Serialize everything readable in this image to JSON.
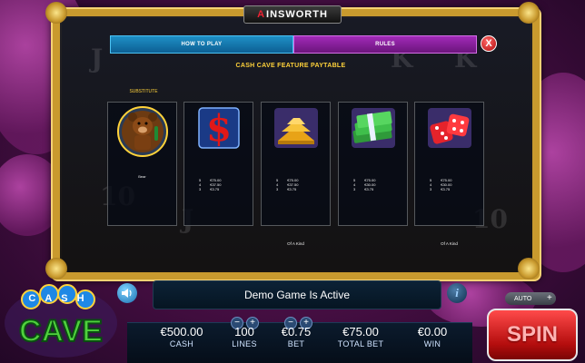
{
  "brand": {
    "name_first": "A",
    "name_rest": "INSWORTH"
  },
  "tabs": {
    "how_to_play": "HOW TO PLAY",
    "rules": "RULES"
  },
  "close_label": "X",
  "paytable": {
    "title": "CASH CAVE FEATURE PAYTABLE",
    "substitute_label": "SUBSTITUTE",
    "bear_caption": "Bear",
    "cards": [
      {
        "icon": "bear-icon",
        "pays": []
      },
      {
        "icon": "dollar-sign-icon",
        "pays": [
          [
            "5",
            "€75.00"
          ],
          [
            "4",
            "€37.50"
          ],
          [
            "3",
            "€3.75"
          ]
        ]
      },
      {
        "icon": "gold-bars-icon",
        "pays": [
          [
            "5",
            "€75.00"
          ],
          [
            "4",
            "€37.50"
          ],
          [
            "3",
            "€3.75"
          ]
        ]
      },
      {
        "icon": "cash-stack-icon",
        "pays": [
          [
            "5",
            "€75.00"
          ],
          [
            "4",
            "€30.00"
          ],
          [
            "3",
            "€3.75"
          ]
        ]
      },
      {
        "icon": "dice-icon",
        "pays": [
          [
            "5",
            "€75.00"
          ],
          [
            "4",
            "€30.00"
          ],
          [
            "3",
            "€3.75"
          ]
        ]
      }
    ],
    "of_a_kind": "Of A Kind"
  },
  "message": "Demo Game Is Active",
  "stats": {
    "cash": {
      "value": "€500.00",
      "label": "CASH"
    },
    "lines": {
      "value": "100",
      "label": "LINES"
    },
    "bet": {
      "value": "€0.75",
      "label": "BET"
    },
    "total_bet": {
      "value": "€75.00",
      "label": "TOTAL BET"
    },
    "win": {
      "value": "€0.00",
      "label": "WIN"
    }
  },
  "controls": {
    "auto_label": "AUTO",
    "auto_plus": "+",
    "spin_label": "SPIN",
    "minus": "−",
    "plus": "+",
    "info": "i"
  },
  "logo": {
    "top": "CASH",
    "bottom": "CAVE"
  },
  "colors": {
    "accent_gold": "#ffd23a",
    "tab_blue": "#1e90c6",
    "tab_purple": "#a12ab8",
    "spin_red": "#d81b1b"
  }
}
